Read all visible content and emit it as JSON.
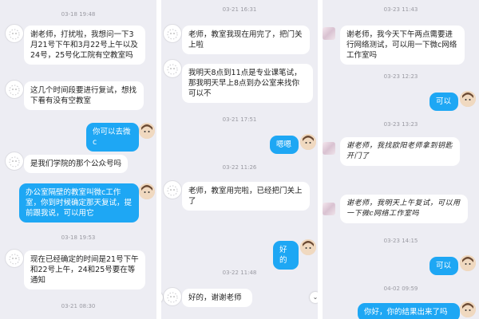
{
  "panel1": {
    "timestamps": [
      "03-18 19:48",
      "03-18 19:53",
      "03-21 08:30"
    ],
    "messages": [
      {
        "text": "谢老师，打扰啦，我想问一下3月21号下午和3月22号上午以及24号，25号化工院有空教室吗",
        "dir": "in"
      },
      {
        "text": "这几个时间段要进行复试，想找下看有没有空教室",
        "dir": "in"
      },
      {
        "text": "你可以去微c",
        "dir": "out"
      },
      {
        "text": "是我们学院的那个公众号吗",
        "dir": "in"
      },
      {
        "text": "办公室隔壁的教室叫微c工作室，你到时候确定那天复试，提前跟我说，可以用它",
        "dir": "out"
      },
      {
        "text": "现在已经确定的时间是21号下午和22号上午，24和25号要在等通知",
        "dir": "in"
      }
    ]
  },
  "panel2": {
    "timestamps": [
      "03-21 16:31",
      "03-21 17:51",
      "03-22 11:26",
      "03-22 11:48"
    ],
    "messages": [
      {
        "text": "老师，教室我现在用完了，把门关上啦",
        "dir": "in"
      },
      {
        "text": "我明天8点到11点是专业课笔试，那我明天早上8点到办公室来找你可以不",
        "dir": "in"
      },
      {
        "text": "嗯嗯",
        "dir": "out"
      },
      {
        "text": "老师，教室用完啦，已经把门关上了",
        "dir": "in"
      },
      {
        "text": "好的",
        "dir": "out"
      },
      {
        "text": "好的，谢谢老师",
        "dir": "in"
      }
    ]
  },
  "panel3": {
    "timestamps": [
      "03-23 11:43",
      "03-23 12:23",
      "03-23 13:23",
      "03-23 14:15",
      "04-02 09:59"
    ],
    "messages": [
      {
        "text": "谢老师，我今天下午两点需要进行网络测试，可以用一下微c网络工作室吗",
        "dir": "in"
      },
      {
        "text": "可以",
        "dir": "out"
      },
      {
        "text": "谢老师，我找欧阳老师拿到钥匙开门了",
        "dir": "in"
      },
      {
        "text": "谢老师，我明天上午复试，可以用一下微c网络工作室吗",
        "dir": "in"
      },
      {
        "text": "可以",
        "dir": "out"
      },
      {
        "text": "你好，你的结果出来了吗",
        "dir": "out"
      }
    ]
  },
  "icons": {
    "scroll_down": "chevron-down-icon",
    "avatar_student": "doodle-avatar",
    "avatar_teacher": "girl-avatar"
  },
  "colors": {
    "outgoing_bubble": "#1ea7f4",
    "incoming_bubble": "#ffffff",
    "background": "#ededf3"
  }
}
